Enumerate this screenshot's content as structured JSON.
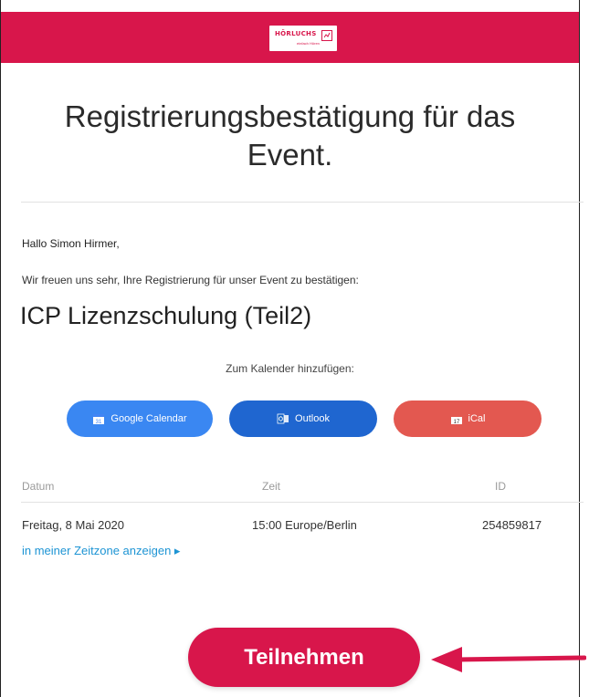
{
  "logo": {
    "text": "HÖRLUCHS",
    "tagline": "einfach Hören"
  },
  "title": {
    "line1": "Registrierungsbestätigung für das",
    "line2": "Event."
  },
  "greeting": "Hallo Simon Hirmer,",
  "intro": "Wir freuen uns sehr, Ihre Registrierung für unser Event zu bestätigen:",
  "event_name": "ICP Lizenzschulung (Teil2)",
  "calendar": {
    "label": "Zum Kalender hinzufügen:",
    "buttons": [
      {
        "label": "Google Calendar",
        "icon": "google-calendar-icon",
        "color": "#3a87f2"
      },
      {
        "label": "Outlook",
        "icon": "outlook-icon",
        "color": "#1f66d0"
      },
      {
        "label": "iCal",
        "icon": "ical-icon",
        "color": "#e35850"
      }
    ]
  },
  "table": {
    "headers": [
      "Datum",
      "Zeit",
      "ID"
    ],
    "row": [
      "Freitag, 8 Mai 2020",
      "15:00 Europe/Berlin",
      "254859817"
    ]
  },
  "timezone_link": "in meiner Zeitzone anzeigen ▸",
  "join_button": "Teilnehmen",
  "colors": {
    "brand": "#d8164b",
    "link": "#1d94d4",
    "arrow": "#d8164b"
  }
}
